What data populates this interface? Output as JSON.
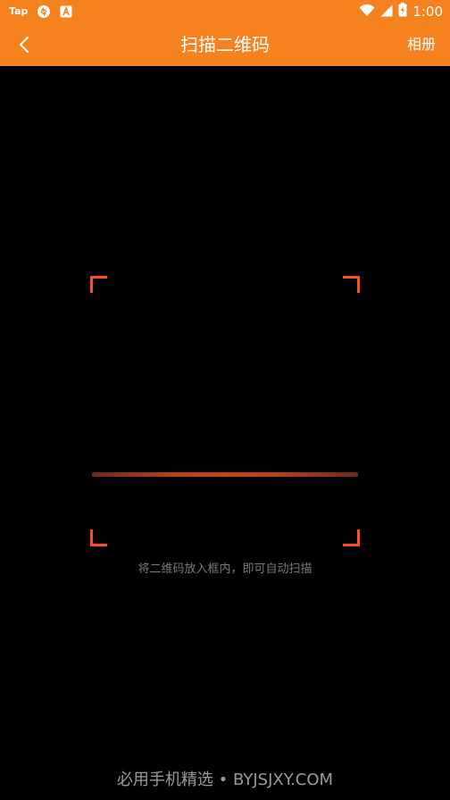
{
  "status_bar": {
    "left_icons": [
      "Tap",
      "sync-icon",
      "a-box-icon"
    ],
    "time": "1:00"
  },
  "toolbar": {
    "title": "扫描二维码",
    "album_label": "相册",
    "back_icon": "chevron-left-icon"
  },
  "scanner": {
    "hint": "将二维码放入框内，即可自动扫描"
  },
  "watermark": "必用手机精选 • BYJSJXY.COM",
  "colors": {
    "accent": "#F5821F",
    "corner": "#FF4D1C",
    "scan_line": "#C8451C",
    "background": "#000000"
  }
}
